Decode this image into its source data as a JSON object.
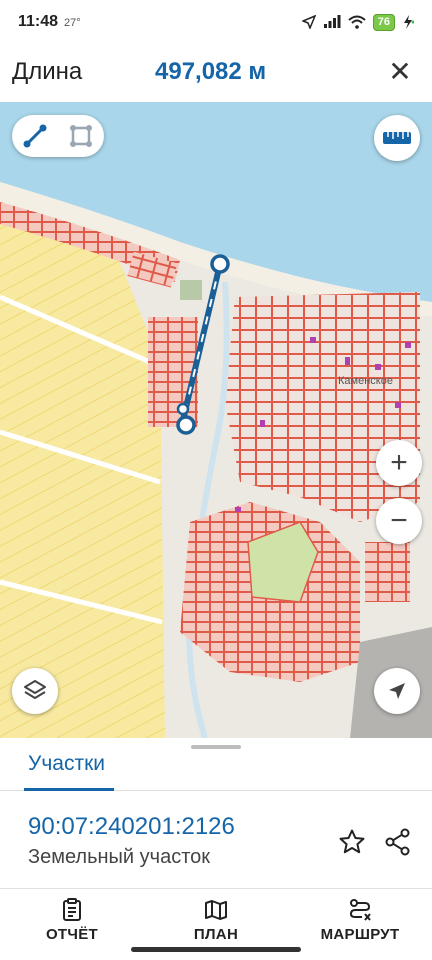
{
  "status_bar": {
    "time": "11:48",
    "temperature": "27°",
    "battery": "76"
  },
  "header": {
    "title": "Длина",
    "value": "497,082 м",
    "close_label": "✕"
  },
  "map": {
    "colors": {
      "water": "#a9d6ea",
      "land": "#ece9e3",
      "parcel_stroke": "#e05a4a",
      "parcel_fill": "#f4c9bf",
      "yellow_zone": "#f7e9a0",
      "measure_line": "#1a5f96",
      "green_area": "#cfe3a8",
      "building_purple": "#b03fb0"
    },
    "zoom_in_label": "+",
    "zoom_out_label": "−",
    "labels": {
      "village": "Каменское"
    }
  },
  "bottom_panel": {
    "section_title": "Участки",
    "parcel": {
      "id": "90:07:240201:2126",
      "type": "Земельный участок"
    }
  },
  "bottom_nav": [
    {
      "label": "ОТЧЁТ",
      "icon": "report-icon"
    },
    {
      "label": "ПЛАН",
      "icon": "map-plan-icon"
    },
    {
      "label": "МАРШРУТ",
      "icon": "route-icon"
    }
  ]
}
